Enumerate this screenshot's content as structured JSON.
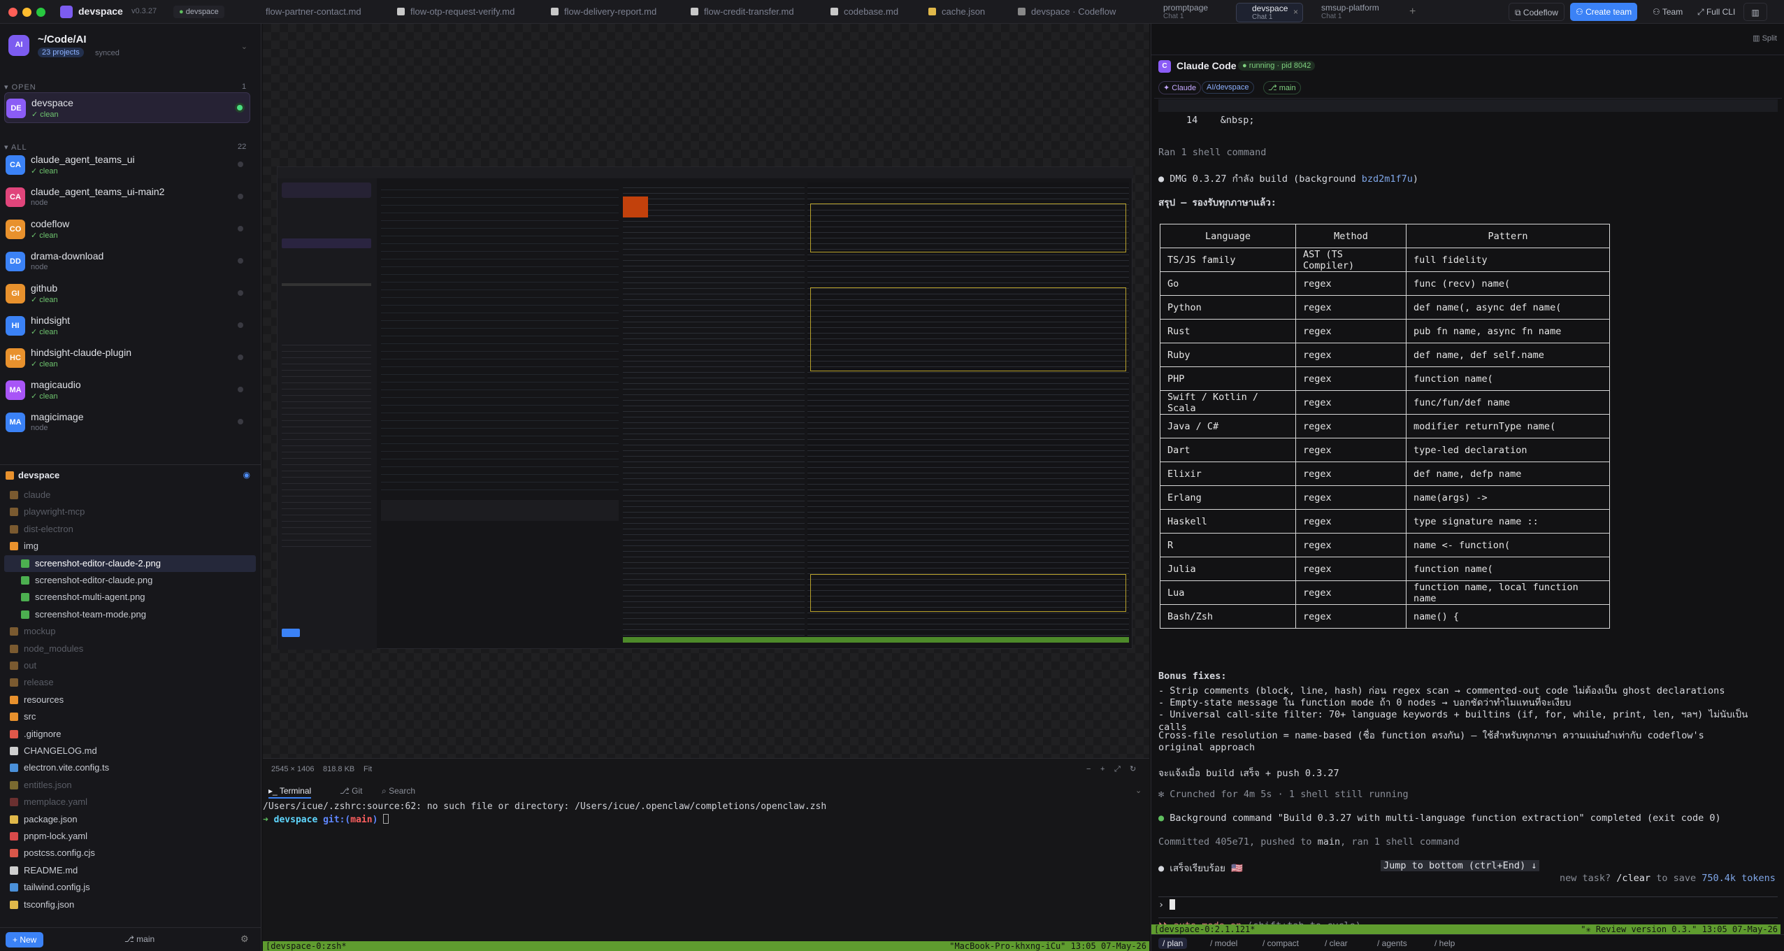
{
  "app": {
    "name": "devspace",
    "version": "v0.3.27",
    "workspace_tag": "devspace"
  },
  "colors": {
    "accent": "#3b82f6",
    "green": "#5fbf5f",
    "purple": "#8b5cf6",
    "bg": "#141416"
  },
  "editor_tabs": [
    "flow-partner-contact.md",
    "flow-otp-request-verify.md",
    "flow-delivery-report.md",
    "flow-credit-transfer.md",
    "codebase.md",
    "cache.json",
    "devspace · Codeflow"
  ],
  "session_tabs": [
    {
      "name": "promptpage",
      "sub": "Chat 1"
    },
    {
      "name": "devspace",
      "sub": "Chat 1"
    },
    {
      "name": "smsup-platform",
      "sub": "Chat 1"
    }
  ],
  "top_right": {
    "codeflow": "Codeflow",
    "create_team": "Create team",
    "team": "Team",
    "full_cli": "Full CLI",
    "split": "Split"
  },
  "workspace": {
    "avatar": "AI",
    "path": "~/Code/AI",
    "projects": "23 projects",
    "status": "synced"
  },
  "sections": {
    "open": "OPEN",
    "open_count": "1",
    "all": "ALL",
    "all_count": "22"
  },
  "open_projects": [
    {
      "initials": "DE",
      "name": "devspace",
      "status": "✓ clean",
      "color": "#8b5cf6"
    }
  ],
  "all_projects": [
    {
      "initials": "CA",
      "name": "claude_agent_teams_ui",
      "status": "✓ clean",
      "clean": true,
      "color": "#3b82f6"
    },
    {
      "initials": "CA",
      "name": "claude_agent_teams_ui-main2",
      "status": "node",
      "clean": false,
      "color": "#e0457b"
    },
    {
      "initials": "CO",
      "name": "codeflow",
      "status": "✓ clean",
      "clean": true,
      "color": "#e8912d"
    },
    {
      "initials": "DD",
      "name": "drama-download",
      "status": "node",
      "clean": false,
      "color": "#3b82f6"
    },
    {
      "initials": "GI",
      "name": "github",
      "status": "✓ clean",
      "clean": true,
      "color": "#e8912d"
    },
    {
      "initials": "HI",
      "name": "hindsight",
      "status": "✓ clean",
      "clean": true,
      "color": "#3b82f6"
    },
    {
      "initials": "HC",
      "name": "hindsight-claude-plugin",
      "status": "✓ clean",
      "clean": true,
      "color": "#e8912d"
    },
    {
      "initials": "MA",
      "name": "magicaudio",
      "status": "✓ clean",
      "clean": true,
      "color": "#a855f7"
    },
    {
      "initials": "MA",
      "name": "magicimage",
      "status": "node",
      "clean": false,
      "color": "#3b82f6"
    }
  ],
  "file_tree": {
    "root": "devspace",
    "items": [
      {
        "label": "claude",
        "kind": "dir-dim",
        "depth": 0
      },
      {
        "label": "playwright-mcp",
        "kind": "dir-dim",
        "depth": 0
      },
      {
        "label": "dist-electron",
        "kind": "dir-dim",
        "depth": 0
      },
      {
        "label": "img",
        "kind": "dir",
        "depth": 0
      },
      {
        "label": "screenshot-editor-claude-2.png",
        "kind": "png",
        "depth": 1,
        "active": true
      },
      {
        "label": "screenshot-editor-claude.png",
        "kind": "png",
        "depth": 1
      },
      {
        "label": "screenshot-multi-agent.png",
        "kind": "png",
        "depth": 1
      },
      {
        "label": "screenshot-team-mode.png",
        "kind": "png",
        "depth": 1
      },
      {
        "label": "mockup",
        "kind": "dir-dim",
        "depth": 0
      },
      {
        "label": "node_modules",
        "kind": "dir-dim",
        "depth": 0
      },
      {
        "label": "out",
        "kind": "dir-dim",
        "depth": 0
      },
      {
        "label": "release",
        "kind": "dir-dim",
        "depth": 0
      },
      {
        "label": "resources",
        "kind": "dir",
        "depth": 0
      },
      {
        "label": "src",
        "kind": "dir",
        "depth": 0
      },
      {
        "label": ".gitignore",
        "kind": "git",
        "depth": 0
      },
      {
        "label": "CHANGELOG.md",
        "kind": "md",
        "depth": 0
      },
      {
        "label": "electron.vite.config.ts",
        "kind": "ts",
        "depth": 0
      },
      {
        "label": "entitles.json",
        "kind": "json-dim",
        "depth": 0
      },
      {
        "label": "memplace.yaml",
        "kind": "yaml-dim",
        "depth": 0
      },
      {
        "label": "package.json",
        "kind": "json",
        "depth": 0
      },
      {
        "label": "pnpm-lock.yaml",
        "kind": "yaml",
        "depth": 0
      },
      {
        "label": "postcss.config.cjs",
        "kind": "cfg",
        "depth": 0
      },
      {
        "label": "README.md",
        "kind": "md",
        "depth": 0
      },
      {
        "label": "tailwind.config.js",
        "kind": "ts",
        "depth": 0
      },
      {
        "label": "tsconfig.json",
        "kind": "json",
        "depth": 0
      }
    ]
  },
  "sidebar_footer": {
    "new": "New",
    "branch": "main"
  },
  "image_info": {
    "size": "2545 × 1406",
    "filesize": "818.8 KB",
    "fit": "Fit"
  },
  "terminal_tabs": {
    "terminal": "Terminal",
    "git": "Git",
    "search": "Search"
  },
  "terminal": {
    "line1": "/Users/icue/.zshrc:source:62: no such file or directory: /Users/icue/.openclaw/completions/openclaw.zsh",
    "prompt_arrow": "➜",
    "prompt_dir": "devspace",
    "prompt_git": "git:(",
    "prompt_branch": "main",
    "prompt_close": ")"
  },
  "tmux_left": {
    "left": "[devspace-0:zsh*",
    "right": "\"MacBook-Pro-khxng-iCu\" 13:05 07-May-26"
  },
  "claude": {
    "title": "Claude Code",
    "status": "running · pid 8042",
    "chips": [
      "✦ Claude",
      "AI/devspace",
      "⎇ main"
    ],
    "header_line": "14    &nbsp;",
    "ran1": "Ran 1 shell command",
    "dmg": "DMG 0.3.27 กำลัง build (background ",
    "dmg_id": "bzd2m1f7u",
    "dmg_tail": ")",
    "summary": "สรุป — รองรับทุกภาษาแล้ว:",
    "table_head": [
      "Language",
      "Method",
      "Pattern"
    ],
    "table_rows": [
      [
        "TS/JS family",
        "AST (TS Compiler)",
        "full fidelity"
      ],
      [
        "Go",
        "regex",
        "func (recv) name("
      ],
      [
        "Python",
        "regex",
        "def name(, async def name("
      ],
      [
        "Rust",
        "regex",
        "pub fn name, async fn name"
      ],
      [
        "Ruby",
        "regex",
        "def name, def self.name"
      ],
      [
        "PHP",
        "regex",
        "function name("
      ],
      [
        "Swift / Kotlin / Scala",
        "regex",
        "func/fun/def name"
      ],
      [
        "Java / C#",
        "regex",
        "modifier returnType name("
      ],
      [
        "Dart",
        "regex",
        "type-led declaration"
      ],
      [
        "Elixir",
        "regex",
        "def name, defp name"
      ],
      [
        "Erlang",
        "regex",
        "name(args) ->"
      ],
      [
        "Haskell",
        "regex",
        "type signature name ::"
      ],
      [
        "R",
        "regex",
        "name <- function("
      ],
      [
        "Julia",
        "regex",
        "function name("
      ],
      [
        "Lua",
        "regex",
        "function name, local function name"
      ],
      [
        "Bash/Zsh",
        "regex",
        "name() {"
      ]
    ],
    "bonus_title": "Bonus fixes:",
    "bonus": [
      "- Strip comments (block, line, hash) ก่อน regex scan → commented-out code ไม่ต้องเป็น ghost declarations",
      "- Empty-state message ใน function mode ถ้า 0 nodes → บอกชัดว่าทำไมแทนที่จะเงียบ",
      "- Universal call-site filter: 70+ language keywords + builtins (if, for, while, print, len, ฯลฯ) ไม่นับเป็น calls"
    ],
    "crossfile": "Cross-file resolution = name-based (ชื่อ function ตรงกัน) — ใช้สำหรับทุกภาษา ความแม่นยำเท่ากับ codeflow's original approach",
    "notify": "จะแจ้งเมื่อ build เสร็จ + push 0.3.27",
    "crunched": "✻ Crunched for 4m 5s · 1 shell still running",
    "bg_done": "Background command \"Build 0.3.27 with multi-language function extraction\" completed (exit code 0)",
    "committed_pre": "Committed 405e71, pushed to ",
    "committed_branch": "main",
    "committed_post": ", ran 1 shell command",
    "done": "เสร็จเรียบร้อย 🇺🇸",
    "jump": "Jump to bottom (ctrl+End) ↓",
    "newtask_pre": "new task? ",
    "newtask_cmd": "/clear",
    "newtask_mid": " to save ",
    "newtask_tokens": "750.4k tokens",
    "input_prompt": "›",
    "automode_pre": "⏵⏵ auto mode ",
    "automode_on": "on",
    "automode_post": " (shift+tab to cycle)",
    "status_left": "[devspace-0:2.1.121*",
    "status_right": "\"✳ Review version 0.3.\" 13:05 07-May-26",
    "commands": [
      "/ plan",
      "/ model",
      "/ compact",
      "/ clear",
      "/ agents",
      "/ help"
    ]
  }
}
